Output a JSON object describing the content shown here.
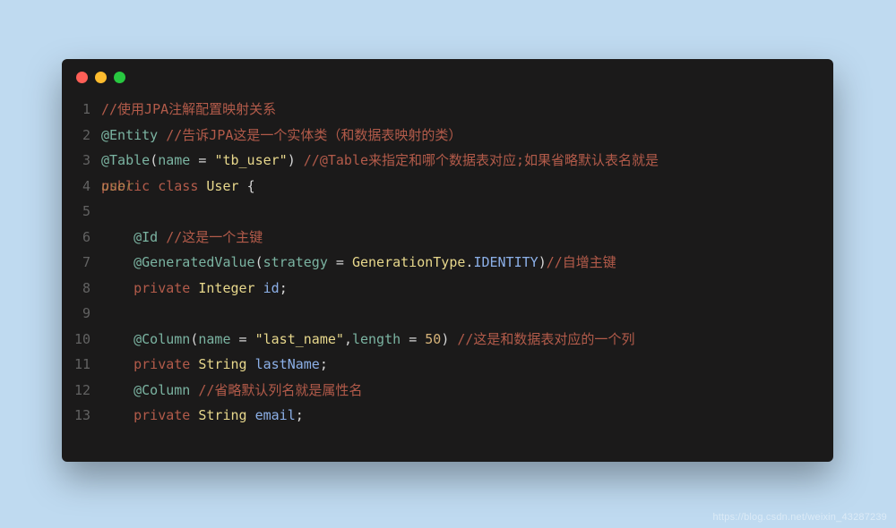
{
  "colors": {
    "bg": "#bfdaf0",
    "window": "#1b1a1a",
    "dot_red": "#ff5f57",
    "dot_yellow": "#febc2e",
    "dot_green": "#28c840"
  },
  "watermark": "https://blog.csdn.net/weixin_43287239",
  "code": {
    "lines": [
      {
        "n": 1,
        "tokens": [
          [
            "comment",
            "//使用JPA注解配置映射关系"
          ]
        ]
      },
      {
        "n": 2,
        "tokens": [
          [
            "annot",
            "@Entity"
          ],
          [
            "plain",
            " "
          ],
          [
            "comment",
            "//告诉JPA这是一个实体类（和数据表映射的类）"
          ]
        ]
      },
      {
        "n": 3,
        "tokens": [
          [
            "annot",
            "@Table"
          ],
          [
            "punct",
            "("
          ],
          [
            "ident",
            "name"
          ],
          [
            "plain",
            " "
          ],
          [
            "punct",
            "="
          ],
          [
            "plain",
            " "
          ],
          [
            "string",
            "\"tb_user\""
          ],
          [
            "punct",
            ")"
          ],
          [
            "plain",
            " "
          ],
          [
            "comment",
            "//@Table来指定和哪个数据表对应;如果省略默认表名就是"
          ]
        ]
      },
      {
        "n": 4,
        "tokens": [
          [
            "keyword",
            "public"
          ],
          [
            "plain",
            " "
          ],
          [
            "keyword",
            "class"
          ],
          [
            "plain",
            " "
          ],
          [
            "type",
            "User"
          ],
          [
            "plain",
            " "
          ],
          [
            "punct",
            "{"
          ]
        ],
        "overlay": "user"
      },
      {
        "n": 5,
        "tokens": []
      },
      {
        "n": 6,
        "tokens": [
          [
            "plain",
            "    "
          ],
          [
            "annot",
            "@Id"
          ],
          [
            "plain",
            " "
          ],
          [
            "comment",
            "//这是一个主键"
          ]
        ]
      },
      {
        "n": 7,
        "tokens": [
          [
            "plain",
            "    "
          ],
          [
            "annot",
            "@GeneratedValue"
          ],
          [
            "punct",
            "("
          ],
          [
            "ident",
            "strategy"
          ],
          [
            "plain",
            " "
          ],
          [
            "punct",
            "="
          ],
          [
            "plain",
            " "
          ],
          [
            "type",
            "GenerationType"
          ],
          [
            "punct",
            "."
          ],
          [
            "field",
            "IDENTITY"
          ],
          [
            "punct",
            ")"
          ],
          [
            "comment",
            "//自增主键"
          ]
        ]
      },
      {
        "n": 8,
        "tokens": [
          [
            "plain",
            "    "
          ],
          [
            "keyword",
            "private"
          ],
          [
            "plain",
            " "
          ],
          [
            "type",
            "Integer"
          ],
          [
            "plain",
            " "
          ],
          [
            "field",
            "id"
          ],
          [
            "punct",
            ";"
          ]
        ]
      },
      {
        "n": 9,
        "tokens": []
      },
      {
        "n": 10,
        "tokens": [
          [
            "plain",
            "    "
          ],
          [
            "annot",
            "@Column"
          ],
          [
            "punct",
            "("
          ],
          [
            "ident",
            "name"
          ],
          [
            "plain",
            " "
          ],
          [
            "punct",
            "="
          ],
          [
            "plain",
            " "
          ],
          [
            "string",
            "\"last_name\""
          ],
          [
            "punct",
            ","
          ],
          [
            "ident",
            "length"
          ],
          [
            "plain",
            " "
          ],
          [
            "punct",
            "="
          ],
          [
            "plain",
            " "
          ],
          [
            "number",
            "50"
          ],
          [
            "punct",
            ")"
          ],
          [
            "plain",
            " "
          ],
          [
            "comment",
            "//这是和数据表对应的一个列"
          ]
        ]
      },
      {
        "n": 11,
        "tokens": [
          [
            "plain",
            "    "
          ],
          [
            "keyword",
            "private"
          ],
          [
            "plain",
            " "
          ],
          [
            "type",
            "String"
          ],
          [
            "plain",
            " "
          ],
          [
            "field",
            "lastName"
          ],
          [
            "punct",
            ";"
          ]
        ]
      },
      {
        "n": 12,
        "tokens": [
          [
            "plain",
            "    "
          ],
          [
            "annot",
            "@Column"
          ],
          [
            "plain",
            " "
          ],
          [
            "comment",
            "//省略默认列名就是属性名"
          ]
        ]
      },
      {
        "n": 13,
        "tokens": [
          [
            "plain",
            "    "
          ],
          [
            "keyword",
            "private"
          ],
          [
            "plain",
            " "
          ],
          [
            "type",
            "String"
          ],
          [
            "plain",
            " "
          ],
          [
            "field",
            "email"
          ],
          [
            "punct",
            ";"
          ]
        ]
      }
    ]
  }
}
